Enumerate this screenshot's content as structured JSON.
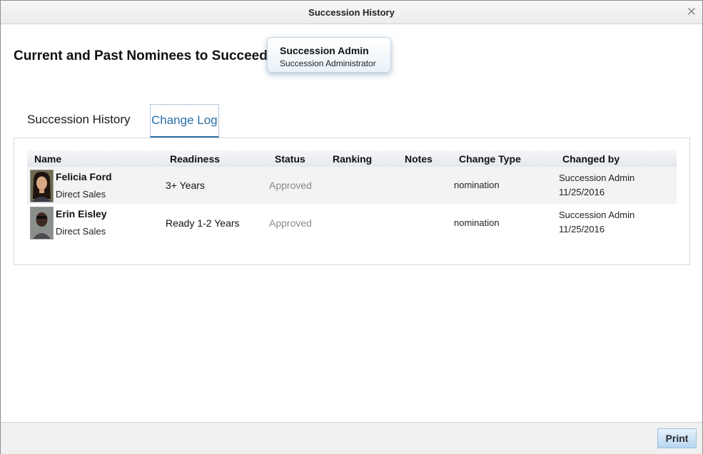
{
  "dialog": {
    "title": "Succession History",
    "close_icon": "close-icon"
  },
  "heading": "Current and Past Nominees to Succeed",
  "position_card": {
    "name": "Succession Admin",
    "role": "Succession Administrator"
  },
  "tabs": [
    {
      "label": "Succession History",
      "active": false
    },
    {
      "label": "Change Log",
      "active": true
    }
  ],
  "table": {
    "columns": [
      "Name",
      "Readiness",
      "Status",
      "Ranking",
      "Notes",
      "Change Type",
      "Changed by"
    ],
    "rows": [
      {
        "name": "Felicia Ford",
        "department": "Direct Sales",
        "readiness": "3+ Years",
        "status": "Approved",
        "ranking": "",
        "notes": "",
        "change_type": "nomination",
        "changed_by": "Succession Admin",
        "changed_date": "11/25/2016"
      },
      {
        "name": "Erin Eisley",
        "department": "Direct Sales",
        "readiness": "Ready 1-2 Years",
        "status": "Approved",
        "ranking": "",
        "notes": "",
        "change_type": "nomination",
        "changed_by": "Succession Admin",
        "changed_date": "11/25/2016"
      }
    ]
  },
  "footer": {
    "print_label": "Print"
  }
}
